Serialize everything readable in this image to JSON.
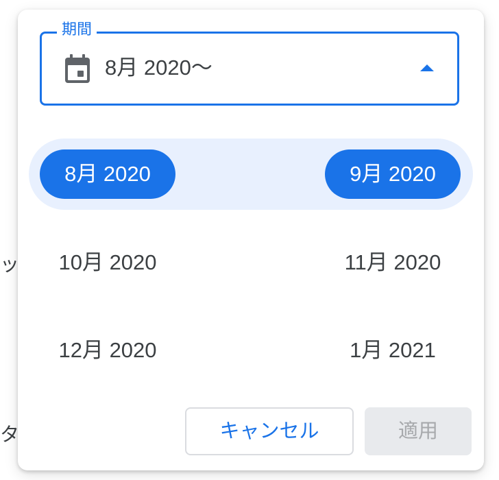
{
  "background": {
    "partial_text_1": "ッ",
    "partial_text_2": "タ"
  },
  "field": {
    "label": "期間",
    "value": "8月 2020〜",
    "icon": "calendar-icon",
    "arrow_icon": "arrow-up-icon"
  },
  "months": [
    {
      "label": "8月 2020",
      "selected": true
    },
    {
      "label": "9月 2020",
      "selected": true
    },
    {
      "label": "10月 2020",
      "selected": false
    },
    {
      "label": "11月 2020",
      "selected": false
    },
    {
      "label": "12月 2020",
      "selected": false
    },
    {
      "label": "1月 2021",
      "selected": false
    }
  ],
  "buttons": {
    "cancel_label": "キャンセル",
    "apply_label": "適用",
    "apply_enabled": false
  },
  "colors": {
    "accent": "#1a73e8",
    "range_band": "#e8f0fe",
    "text": "#3c4043",
    "disabled_bg": "#e8eaed",
    "disabled_text": "#a7a9ac"
  }
}
